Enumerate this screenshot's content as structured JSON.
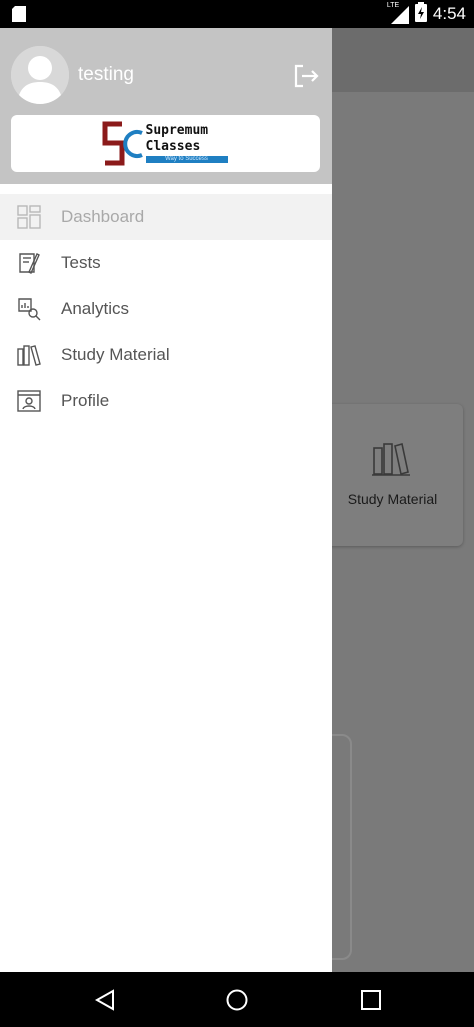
{
  "status_bar": {
    "network_label": "LTE",
    "time": "4:54"
  },
  "background": {
    "card_label": "Study Material",
    "card_icon": "books-icon"
  },
  "drawer": {
    "username": "testing",
    "logo": {
      "line1": "Supremum",
      "line2": "Classes",
      "tagline": "Way to Success"
    },
    "menu": [
      {
        "label": "Dashboard",
        "icon": "dashboard-icon",
        "active": true
      },
      {
        "label": "Tests",
        "icon": "tests-icon",
        "active": false
      },
      {
        "label": "Analytics",
        "icon": "analytics-icon",
        "active": false
      },
      {
        "label": "Study Material",
        "icon": "books-icon",
        "active": false
      },
      {
        "label": "Profile",
        "icon": "profile-icon",
        "active": false
      }
    ]
  },
  "colors": {
    "header_bg": "#c4c4c4",
    "scrim": "#7a7a7a",
    "logo_red": "#8b1a1a",
    "logo_blue": "#1f7fc2"
  }
}
